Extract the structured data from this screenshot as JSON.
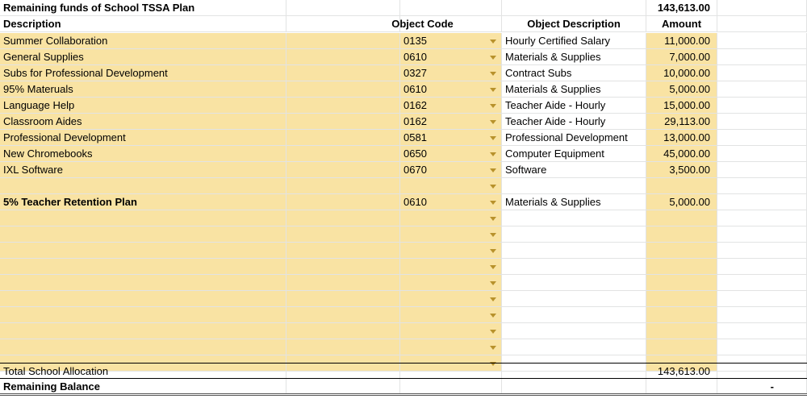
{
  "title": "Remaining funds of School TSSA Plan",
  "title_amount": "143,613.00",
  "headers": {
    "description": "Description",
    "object_code": "Object Code",
    "object_description": "Object Description",
    "amount": "Amount"
  },
  "rows": [
    {
      "description": "Summer Collaboration",
      "code": "0135",
      "object_description": "Hourly Certified Salary",
      "amount": "11,000.00"
    },
    {
      "description": "General Supplies",
      "code": "0610",
      "object_description": "Materials & Supplies",
      "amount": "7,000.00"
    },
    {
      "description": "Subs for Professional Development",
      "code": "0327",
      "object_description": "Contract Subs",
      "amount": "10,000.00"
    },
    {
      "description": "95% Materuals",
      "code": "0610",
      "object_description": "Materials & Supplies",
      "amount": "5,000.00"
    },
    {
      "description": "Language Help",
      "code": "0162",
      "object_description": "Teacher Aide - Hourly",
      "amount": "15,000.00"
    },
    {
      "description": "Classroom Aides",
      "code": "0162",
      "object_description": "Teacher Aide - Hourly",
      "amount": "29,113.00"
    },
    {
      "description": "Professional Development",
      "code": "0581",
      "object_description": "Professional Development",
      "amount": "13,000.00"
    },
    {
      "description": "New Chromebooks",
      "code": "0650",
      "object_description": "Computer Equipment",
      "amount": "45,000.00"
    },
    {
      "description": "IXL Software",
      "code": "0670",
      "object_description": "Software",
      "amount": "3,500.00"
    },
    {
      "description": "",
      "code": "",
      "object_description": "",
      "amount": ""
    },
    {
      "description": "5% Teacher Retention Plan",
      "code": "0610",
      "object_description": "Materials & Supplies",
      "amount": "5,000.00",
      "bold": true
    },
    {
      "description": "",
      "code": "",
      "object_description": "",
      "amount": ""
    },
    {
      "description": "",
      "code": "",
      "object_description": "",
      "amount": ""
    },
    {
      "description": "",
      "code": "",
      "object_description": "",
      "amount": ""
    },
    {
      "description": "",
      "code": "",
      "object_description": "",
      "amount": ""
    },
    {
      "description": "",
      "code": "",
      "object_description": "",
      "amount": ""
    },
    {
      "description": "",
      "code": "",
      "object_description": "",
      "amount": ""
    },
    {
      "description": "",
      "code": "",
      "object_description": "",
      "amount": ""
    },
    {
      "description": "",
      "code": "",
      "object_description": "",
      "amount": ""
    },
    {
      "description": "",
      "code": "",
      "object_description": "",
      "amount": ""
    },
    {
      "description": "",
      "code": "",
      "object_description": "",
      "amount": ""
    }
  ],
  "total": {
    "label": "Total School Allocation",
    "amount": "143,613.00"
  },
  "remaining": {
    "label": "Remaining Balance",
    "value": "-"
  },
  "dropdown_icon": "dropdown-arrow-icon",
  "colors": {
    "highlight": "#f9e3a3",
    "dropdown_arrow": "#b8922c",
    "grid": "#e2e3e3"
  }
}
